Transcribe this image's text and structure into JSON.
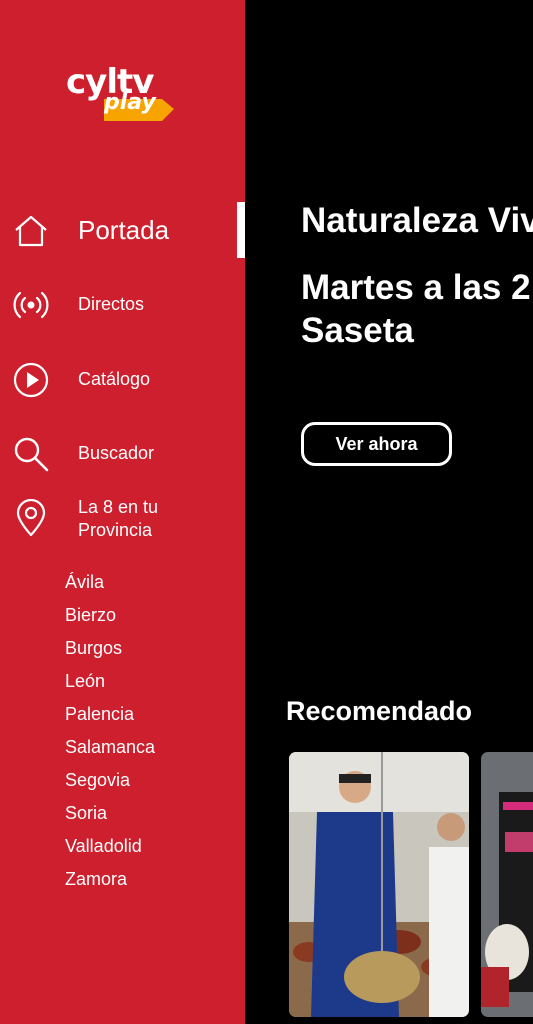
{
  "logo": {
    "word": "cyltv",
    "play": "play"
  },
  "nav": {
    "items": [
      {
        "label": "Portada",
        "icon": "home-icon",
        "active": true
      },
      {
        "label": "Directos",
        "icon": "live-broadcast-icon"
      },
      {
        "label": "Catálogo",
        "icon": "play-circle-icon"
      },
      {
        "label": "Buscador",
        "icon": "search-icon"
      },
      {
        "label": "La 8 en tu Provincia",
        "icon": "location-pin-icon"
      }
    ],
    "provinces": [
      "Ávila",
      "Bierzo",
      "Burgos",
      "León",
      "Palencia",
      "Salamanca",
      "Segovia",
      "Soria",
      "Valladolid",
      "Zamora"
    ]
  },
  "hero": {
    "title": "Naturaleza Viva",
    "subtitle": "Martes a las 2",
    "subtitle2": "Saseta",
    "cta": "Ver ahora"
  },
  "recommended": {
    "title": "Recomendado"
  },
  "colors": {
    "brand_red": "#cd1f2d",
    "play_orange": "#f7a400",
    "background": "#000000"
  }
}
